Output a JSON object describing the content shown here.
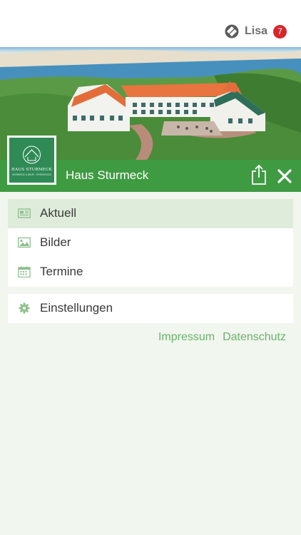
{
  "header": {
    "user_name": "Lisa",
    "notification_count": "7",
    "app_icon": "app-logo-icon"
  },
  "hero": {
    "title": "Haus Sturmeck",
    "logo_text": "HAUS STURMECK",
    "logo_subtext": "HERBERGE & NEUR · SPIEKEROOG",
    "accent_color": "#3f9b41"
  },
  "menu": {
    "items": [
      {
        "label": "Aktuell",
        "icon": "newspaper-icon",
        "active": true
      },
      {
        "label": "Bilder",
        "icon": "image-icon",
        "active": false
      },
      {
        "label": "Termine",
        "icon": "calendar-icon",
        "active": false
      }
    ],
    "settings": {
      "label": "Einstellungen",
      "icon": "gear-icon"
    }
  },
  "footer_links": {
    "impressum": "Impressum",
    "datenschutz": "Datenschutz"
  }
}
